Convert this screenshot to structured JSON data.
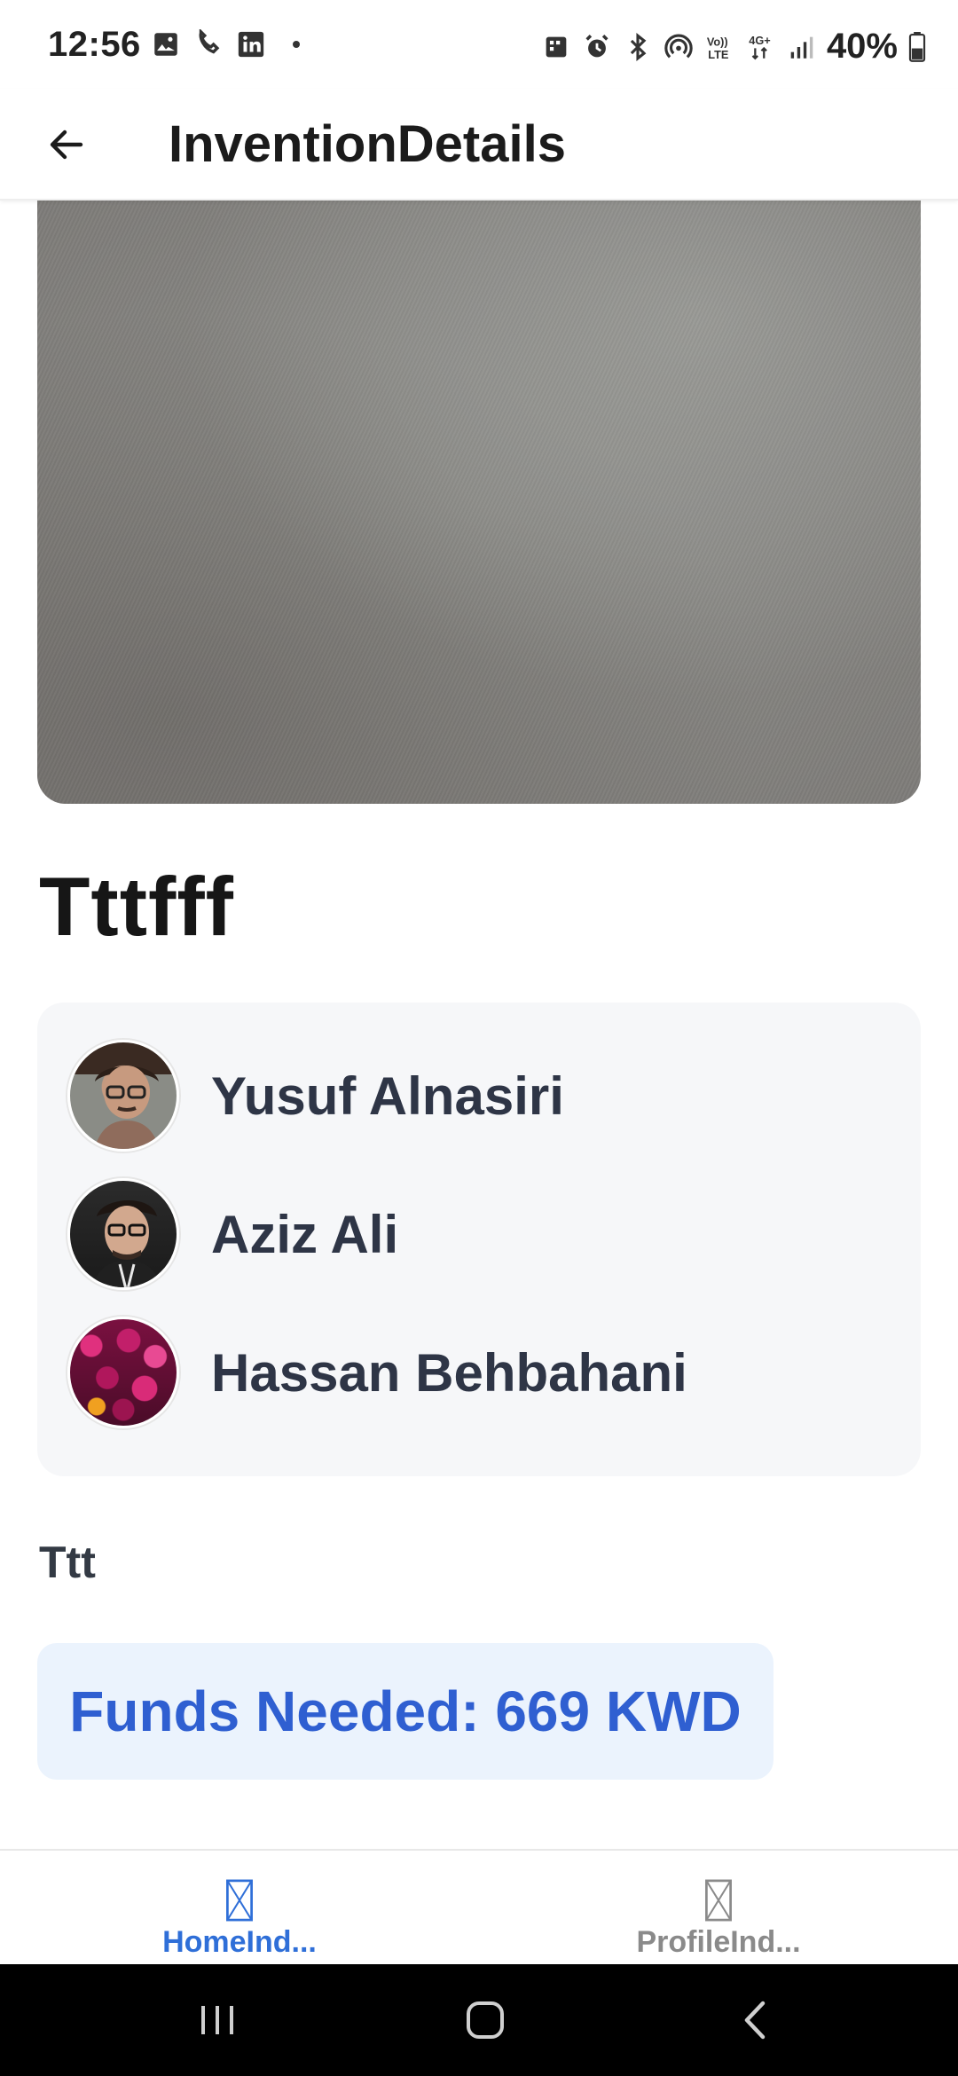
{
  "status_bar": {
    "time": "12:56",
    "battery": "40%",
    "left_icons": [
      "gallery-icon",
      "call-icon",
      "linkedin-icon"
    ],
    "right_icons": [
      "smart-view-icon",
      "alarm-icon",
      "bluetooth-icon",
      "hotspot-icon",
      "volte-icon",
      "4g-icon",
      "signal-icon",
      "battery-icon"
    ]
  },
  "app_bar": {
    "title": "InventionDetails",
    "back_icon": "arrow-left-icon"
  },
  "invention": {
    "title": "Tttfff",
    "description": "Ttt",
    "funds_label": "Funds Needed: 669 KWD"
  },
  "team": {
    "members": [
      {
        "name": "Yusuf Alnasiri"
      },
      {
        "name": "Aziz Ali"
      },
      {
        "name": "Hassan Behbahani"
      }
    ]
  },
  "tabs": [
    {
      "label": "HomeInd...",
      "active": true
    },
    {
      "label": "ProfileInd...",
      "active": false
    }
  ],
  "colors": {
    "accent": "#2f6fd8",
    "funds_bg": "#ebf3fd",
    "funds_text": "#2f5fd1",
    "card_bg": "#f6f7f9",
    "name_text": "#2e3546"
  }
}
